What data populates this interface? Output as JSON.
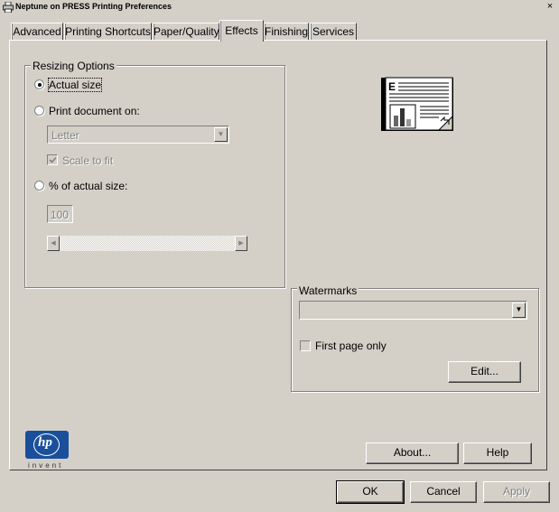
{
  "window": {
    "title": "Neptune on PRESS Printing Preferences",
    "close_glyph": "×"
  },
  "tabs": [
    {
      "label": "Advanced"
    },
    {
      "label": "Printing Shortcuts"
    },
    {
      "label": "Paper/Quality"
    },
    {
      "label": "Effects",
      "active": true
    },
    {
      "label": "Finishing"
    },
    {
      "label": "Services"
    }
  ],
  "resizing": {
    "legend": "Resizing Options",
    "actual_size": {
      "label": "Actual size",
      "selected": true
    },
    "print_document_on": {
      "label": "Print document on:",
      "selected": false
    },
    "paper_value": "Letter",
    "scale_to_fit": {
      "label": "Scale to fit",
      "checked": true,
      "enabled": false
    },
    "percent_actual": {
      "label": "% of actual size:",
      "selected": false
    },
    "percent_value": "100"
  },
  "watermarks": {
    "legend": "Watermarks",
    "value": "",
    "first_page_only": {
      "label": "First page only",
      "checked": false
    },
    "edit_label": "Edit..."
  },
  "logo": {
    "brand": "hp",
    "tagline": "invent",
    "color": "#1a4f9c"
  },
  "buttons": {
    "about": "About...",
    "help": "Help",
    "ok": "OK",
    "cancel": "Cancel",
    "apply": "Apply"
  },
  "icons": {
    "title": "printer-icon",
    "preview": "document-preview-icon",
    "dropdown": "chevron-down-icon"
  },
  "colors": {
    "face": "#d4d0c8",
    "shadow": "#808080",
    "highlight": "#ffffff"
  }
}
